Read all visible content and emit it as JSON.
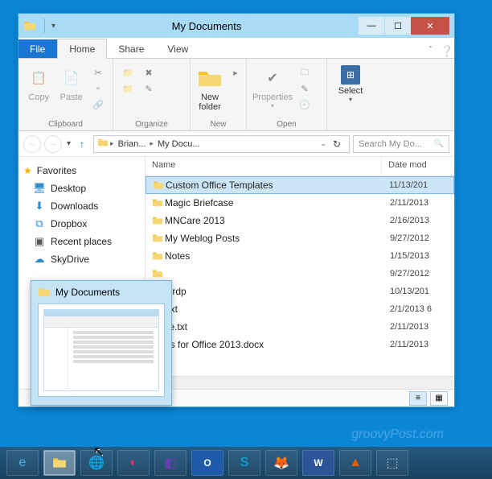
{
  "window": {
    "title": "My Documents",
    "tabs": {
      "file": "File",
      "home": "Home",
      "share": "Share",
      "view": "View"
    }
  },
  "ribbon": {
    "copy": "Copy",
    "paste": "Paste",
    "newfolder": "New\nfolder",
    "properties": "Properties",
    "select": "Select",
    "groups": {
      "clipboard": "Clipboard",
      "organize": "Organize",
      "new": "New",
      "open": "Open"
    }
  },
  "nav": {
    "crumbs": [
      "Brian...",
      "My Docu..."
    ],
    "search_placeholder": "Search My Do..."
  },
  "sidebar": {
    "favorites": "Favorites",
    "items": [
      {
        "label": "Desktop"
      },
      {
        "label": "Downloads"
      },
      {
        "label": "Dropbox"
      },
      {
        "label": "Recent places"
      },
      {
        "label": "SkyDrive"
      }
    ]
  },
  "columns": {
    "name": "Name",
    "date": "Date mod"
  },
  "files": [
    {
      "name": "Custom Office Templates",
      "date": "11/13/201",
      "selected": true,
      "type": "folder"
    },
    {
      "name": "Magic Briefcase",
      "date": "2/11/2013",
      "type": "folder"
    },
    {
      "name": "MNCare 2013",
      "date": "2/16/2013",
      "type": "folder"
    },
    {
      "name": "My Weblog Posts",
      "date": "9/27/2012",
      "type": "folder"
    },
    {
      "name": "Notes",
      "date": "1/15/2013",
      "type": "folder"
    },
    {
      "name": "",
      "date": "9/27/2012",
      "type": "folder"
    },
    {
      "name": "lt.rdp",
      "date": "10/13/201",
      "type": "file"
    },
    {
      "name": ".txt",
      "date": "2/1/2013 6",
      "type": "file"
    },
    {
      "name": "ile.txt",
      "date": "2/11/2013",
      "type": "file"
    },
    {
      "name": "es for Office 2013.docx",
      "date": "2/11/2013",
      "type": "file"
    }
  ],
  "thumb": {
    "title": "My Documents"
  },
  "watermark": "groovyPost.com"
}
